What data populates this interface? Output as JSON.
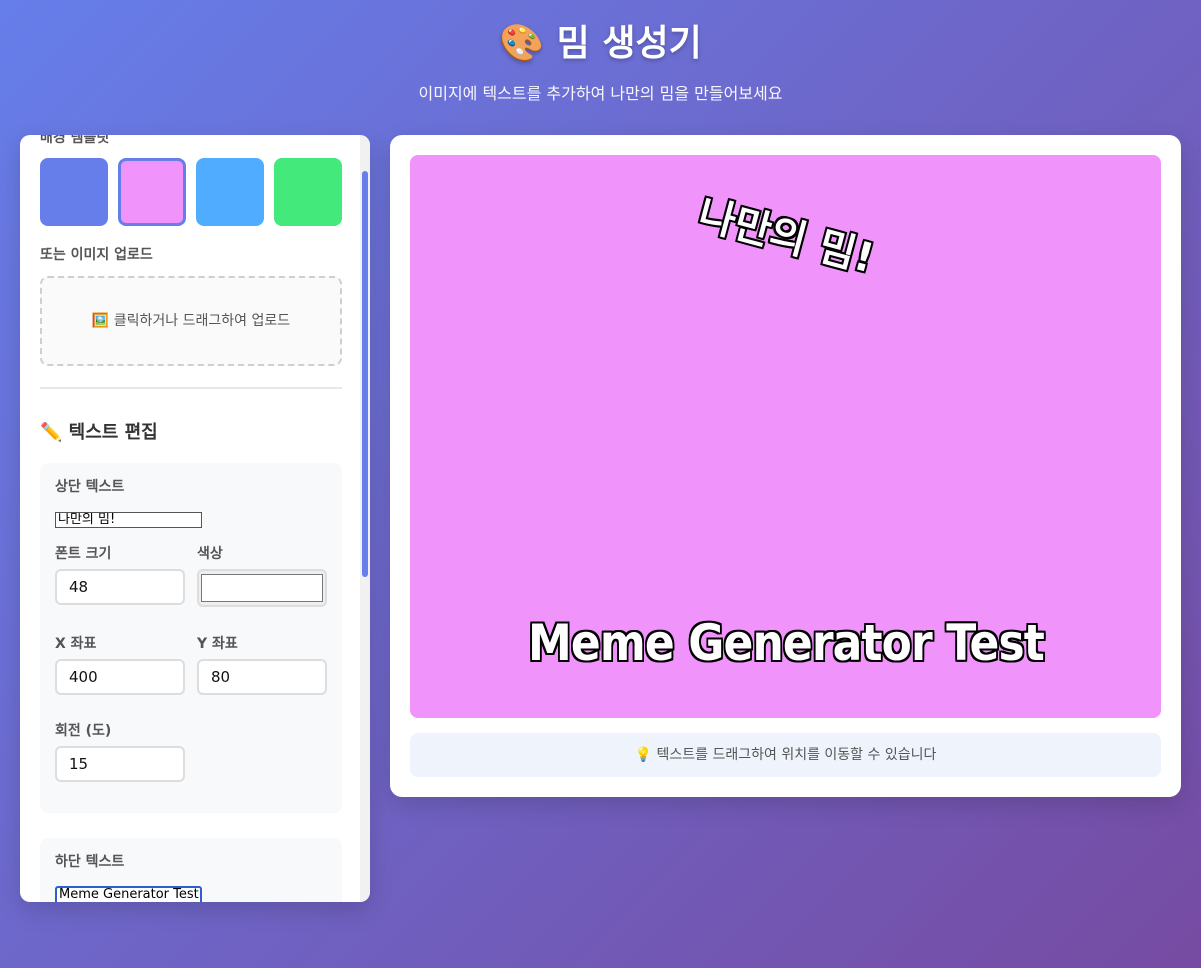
{
  "header": {
    "title": "🎨 밈 생성기",
    "subtitle": "이미지에 텍스트를 추가하여 나만의 밈을 만들어보세요"
  },
  "sidebar": {
    "background_templates_label": "배경 템플릿",
    "templates": [
      {
        "color": "#667eea",
        "selected": false
      },
      {
        "color": "#f093fb",
        "selected": true
      },
      {
        "color": "#4facfe",
        "selected": false
      },
      {
        "color": "#43e97b",
        "selected": false
      }
    ],
    "upload_label": "또는 이미지 업로드",
    "upload_text": "🖼️ 클릭하거나 드래그하여 업로드",
    "text_edit_title": "✏️ 텍스트 편집",
    "top_text": {
      "label": "상단 텍스트",
      "value": "나만의 밈!",
      "font_size_label": "폰트 크기",
      "font_size": "48",
      "color_label": "색상",
      "color": "#ffffff",
      "x_label": "X 좌표",
      "x": "400",
      "y_label": "Y 좌표",
      "y": "80",
      "rotation_label": "회전 (도)",
      "rotation": "15"
    },
    "bottom_text": {
      "label": "하단 텍스트",
      "value": "Meme Generator Test"
    }
  },
  "canvas": {
    "background": "#f093fb",
    "top_text": "나만의 밈!",
    "bottom_text": "Meme Generator Test"
  },
  "hint": "💡 텍스트를 드래그하여 위치를 이동할 수 있습니다"
}
